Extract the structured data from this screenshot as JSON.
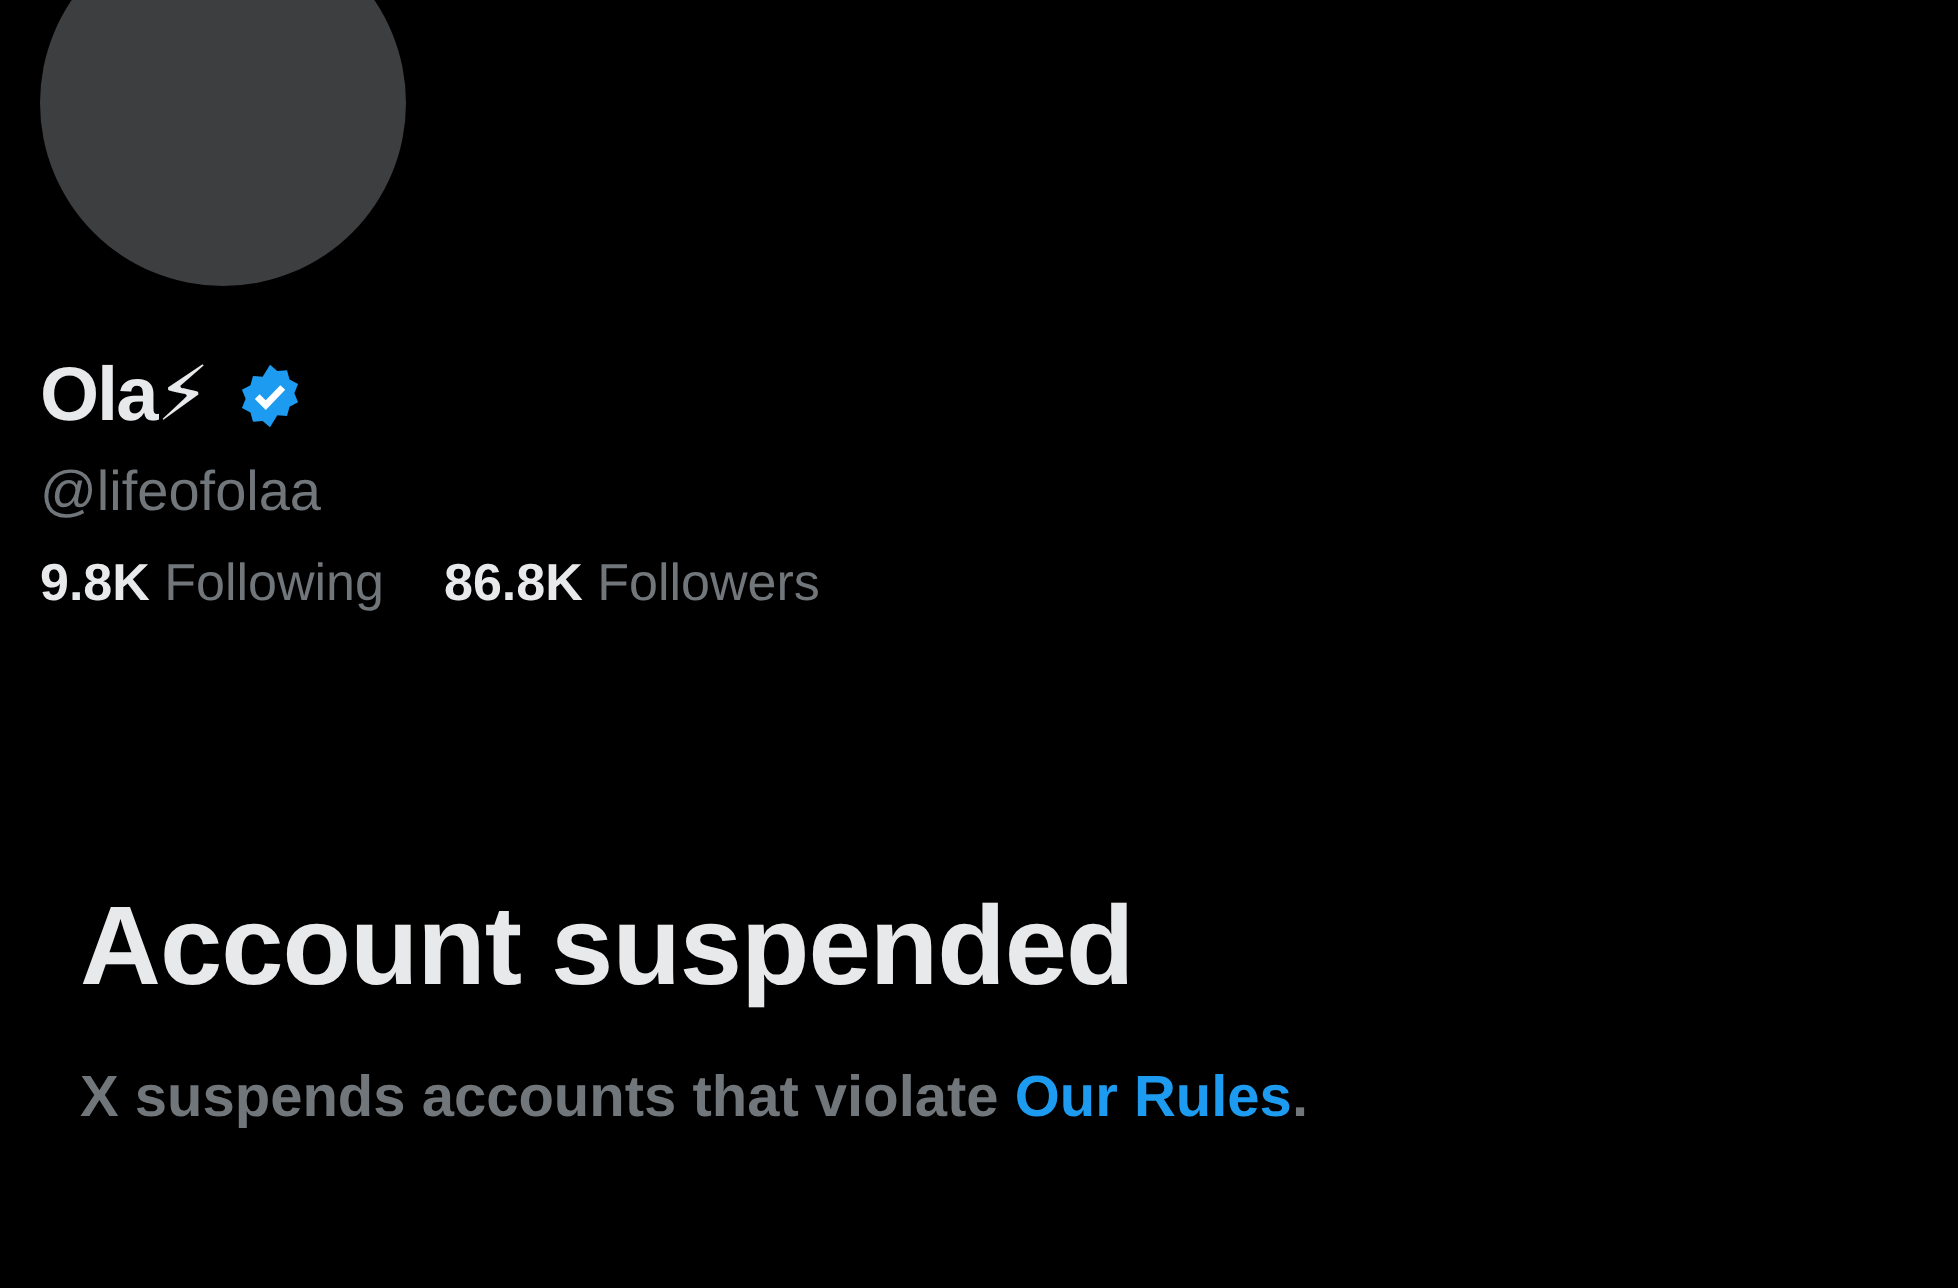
{
  "profile": {
    "name": "Ola⚡",
    "verified": true,
    "handle": "@lifeofolaa",
    "stats": [
      "**9.8K** Following",
      "**86.8K** Followers"
    ]
  },
  "suspension": {
    "title": "Account suspended",
    "message_before": "X suspends accounts that violate ",
    "link": "Our Rules",
    "message_after": "."
  }
}
